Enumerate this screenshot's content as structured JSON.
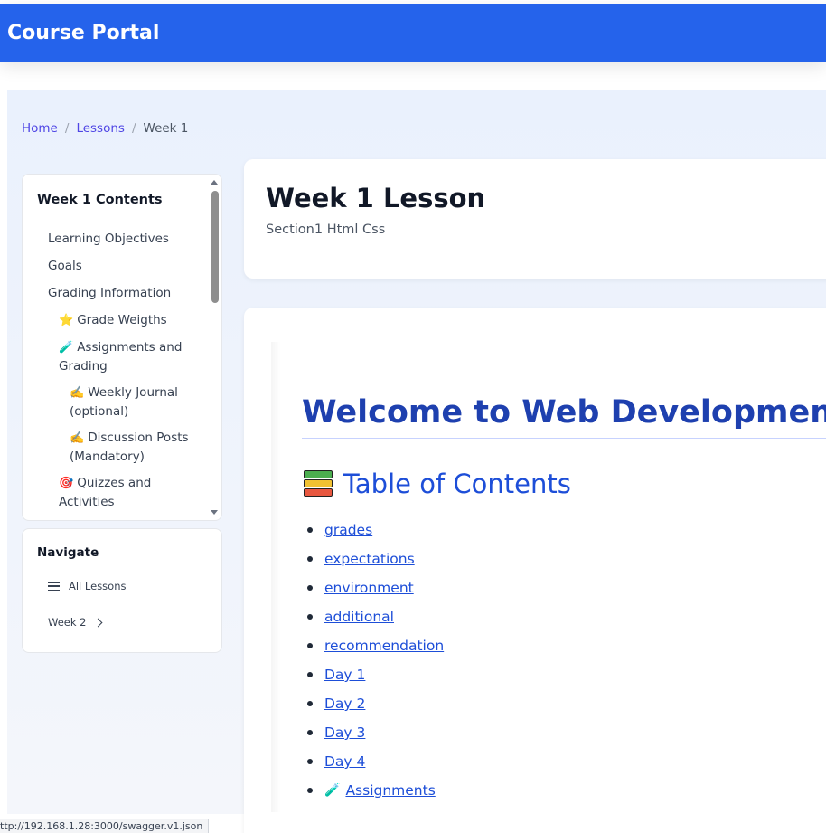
{
  "app": {
    "title": "Course Portal"
  },
  "breadcrumb": {
    "home": "Home",
    "lessons": "Lessons",
    "current": "Week 1",
    "separator": "/"
  },
  "toc": {
    "title": "Week 1 Contents",
    "items": [
      {
        "label": "Learning Objectives",
        "icon": ""
      },
      {
        "label": "Goals",
        "icon": ""
      },
      {
        "label": "Grading Information",
        "icon": ""
      },
      {
        "label": "Grade Weigths",
        "icon": "⭐"
      },
      {
        "label": "Assignments and",
        "label2": "Grading",
        "icon": "🧪"
      },
      {
        "label": "Weekly Journal",
        "label2": "(optional)",
        "icon": "✍️"
      },
      {
        "label": "Discussion Posts",
        "label2": "(Mandatory)",
        "icon": "✍️"
      },
      {
        "label": "Quizzes and",
        "label2": "Activities",
        "icon": "🎯"
      }
    ]
  },
  "navigate": {
    "title": "Navigate",
    "all_lessons": "All Lessons",
    "next": "Week 2"
  },
  "lesson": {
    "title": "Week 1 Lesson",
    "subtitle": "Section1 Html Css"
  },
  "content": {
    "welcome": "Welcome to Web Development!",
    "toc_heading": "Table of Contents",
    "toc_icon": "books-icon",
    "links": [
      {
        "label": "grades"
      },
      {
        "label": "expectations"
      },
      {
        "label": "environment"
      },
      {
        "label": "additional"
      },
      {
        "label": "recommendation"
      },
      {
        "label": "Day 1"
      },
      {
        "label": "Day 2"
      },
      {
        "label": "Day 3"
      },
      {
        "label": "Day 4"
      },
      {
        "label": "Assignments",
        "icon": "🧪"
      }
    ]
  },
  "status": {
    "url": "ttp://192.168.1.28:3000/swagger.v1.json"
  },
  "colors": {
    "brand": "#2563eb",
    "heading": "#1e40af",
    "link": "#1d4ed8"
  }
}
